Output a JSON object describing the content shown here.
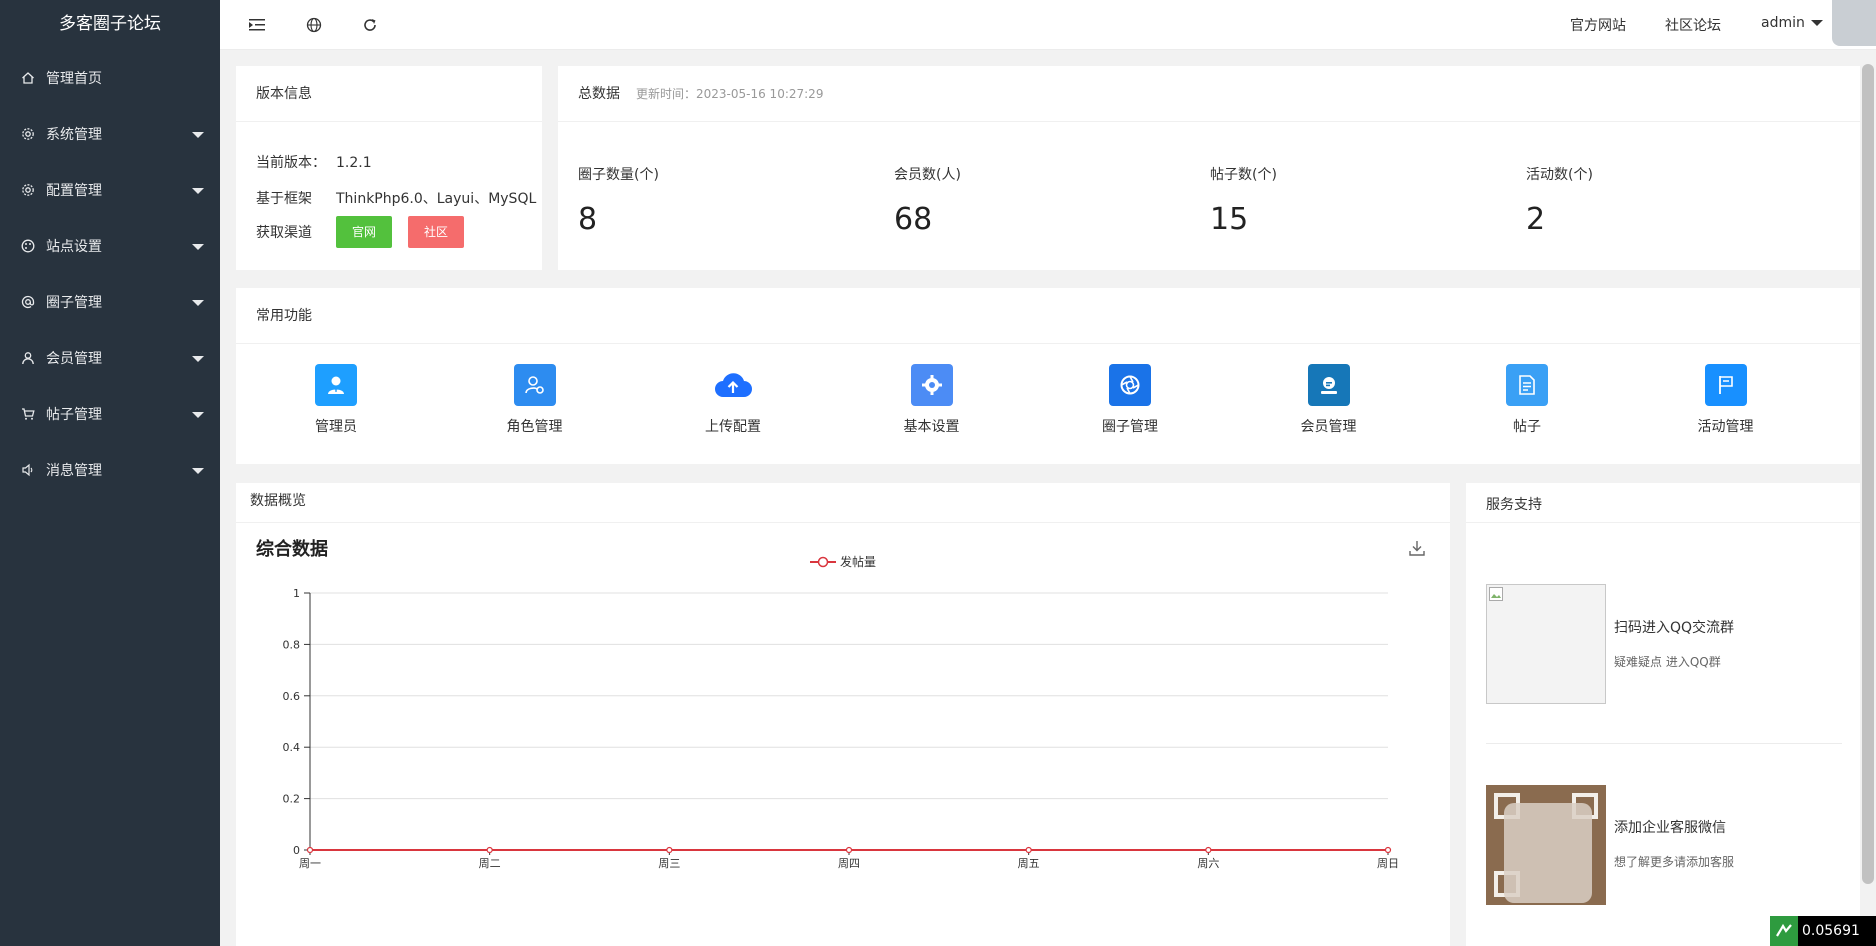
{
  "app": {
    "title": "多客圈子论坛"
  },
  "sidebar": {
    "items": [
      {
        "label": "管理首页",
        "icon": "home-icon",
        "has_arrow": false
      },
      {
        "label": "系统管理",
        "icon": "gear-icon",
        "has_arrow": true
      },
      {
        "label": "配置管理",
        "icon": "gear-icon",
        "has_arrow": true
      },
      {
        "label": "站点设置",
        "icon": "palette-icon",
        "has_arrow": true
      },
      {
        "label": "圈子管理",
        "icon": "at-icon",
        "has_arrow": true
      },
      {
        "label": "会员管理",
        "icon": "user-icon",
        "has_arrow": true
      },
      {
        "label": "帖子管理",
        "icon": "cart-icon",
        "has_arrow": true
      },
      {
        "label": "消息管理",
        "icon": "speaker-icon",
        "has_arrow": true
      }
    ]
  },
  "header": {
    "links": [
      "官方网站",
      "社区论坛"
    ],
    "user": "admin"
  },
  "version_card": {
    "title": "版本信息",
    "rows": [
      {
        "key": "当前版本：",
        "value": "1.2.1"
      },
      {
        "key": "基于框架",
        "value": "ThinkPhp6.0、Layui、MySQL"
      },
      {
        "key": "获取渠道",
        "value": ""
      }
    ],
    "btn_official": "官网",
    "btn_community": "社区"
  },
  "stats_card": {
    "title": "总数据",
    "updated": "更新时间：2023-05-16 10:27:29",
    "stats": [
      {
        "label": "圈子数量(个)",
        "value": "8"
      },
      {
        "label": "会员数(人)",
        "value": "68"
      },
      {
        "label": "帖子数(个)",
        "value": "15"
      },
      {
        "label": "活动数(个)",
        "value": "2"
      }
    ]
  },
  "functions_card": {
    "title": "常用功能",
    "items": [
      {
        "label": "管理员",
        "icon": "admin-user-icon",
        "color": "#1e9fff"
      },
      {
        "label": "角色管理",
        "icon": "role-gear-icon",
        "color": "#2d8cf0"
      },
      {
        "label": "上传配置",
        "icon": "cloud-upload-icon",
        "color": "#1e6fff"
      },
      {
        "label": "基本设置",
        "icon": "settings-gear-icon",
        "color": "#4c8cf5"
      },
      {
        "label": "圈子管理",
        "icon": "aperture-icon",
        "color": "#1a73e8"
      },
      {
        "label": "会员管理",
        "icon": "member-icon",
        "color": "#1677b8"
      },
      {
        "label": "帖子",
        "icon": "document-icon",
        "color": "#3aa0f5"
      },
      {
        "label": "活动管理",
        "icon": "flag-icon",
        "color": "#1890ff"
      }
    ]
  },
  "overview_card": {
    "title": "数据概览",
    "chart_title": "综合数据",
    "legend": "发帖量",
    "download_icon": "download-icon"
  },
  "chart_data": {
    "type": "line",
    "title": "综合数据",
    "categories": [
      "周一",
      "周二",
      "周三",
      "周四",
      "周五",
      "周六",
      "周日"
    ],
    "series": [
      {
        "name": "发帖量",
        "values": [
          0,
          0,
          0,
          0,
          0,
          0,
          0
        ]
      }
    ],
    "yticks": [
      "0",
      "0.2",
      "0.4",
      "0.6",
      "0.8",
      "1"
    ],
    "ylim": [
      0,
      1
    ],
    "grid": true,
    "legend_position": "top-center",
    "line_color": "#d9363e"
  },
  "service_card": {
    "title": "服务支持",
    "items": [
      {
        "title": "扫码进入QQ交流群",
        "sub": "疑难疑点 进入QQ群"
      },
      {
        "title": "添加企业客服微信",
        "sub": "想了解更多请添加客服"
      }
    ]
  },
  "ticker": {
    "value": "0.05691"
  }
}
